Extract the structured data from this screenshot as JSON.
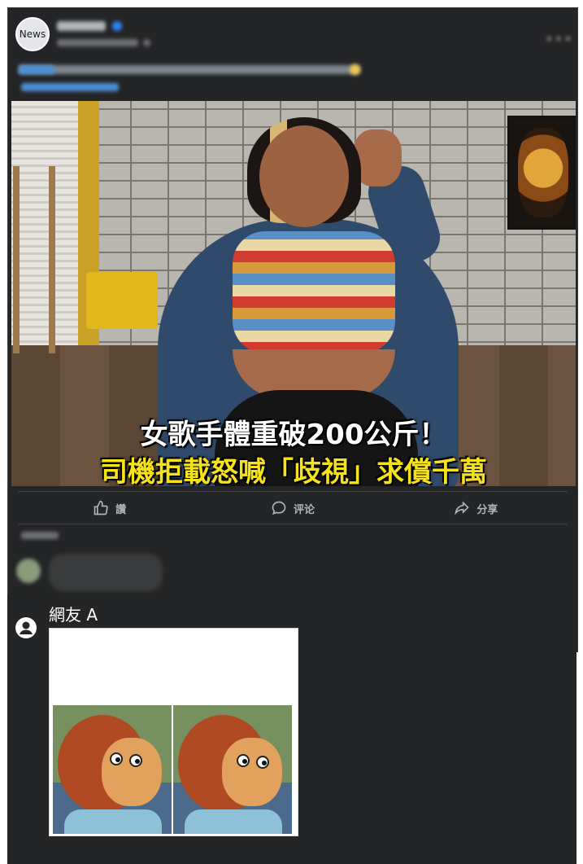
{
  "post": {
    "avatar_label": "News",
    "actions": {
      "like": "讚",
      "comment": "评论",
      "share": "分享"
    }
  },
  "image": {
    "caption_line1": "女歌手體重破200公斤！",
    "caption_line2": "司機拒載怒喊「歧視」求償千萬"
  },
  "comment": {
    "username": "網友 A"
  },
  "colors": {
    "background": "#242526",
    "caption_yellow": "#f6e21a",
    "verified_blue": "#2d88ff"
  },
  "icons": [
    "thumbs-up-icon",
    "comment-icon",
    "share-icon",
    "user-icon",
    "more-icon",
    "verified-icon",
    "globe-icon"
  ]
}
